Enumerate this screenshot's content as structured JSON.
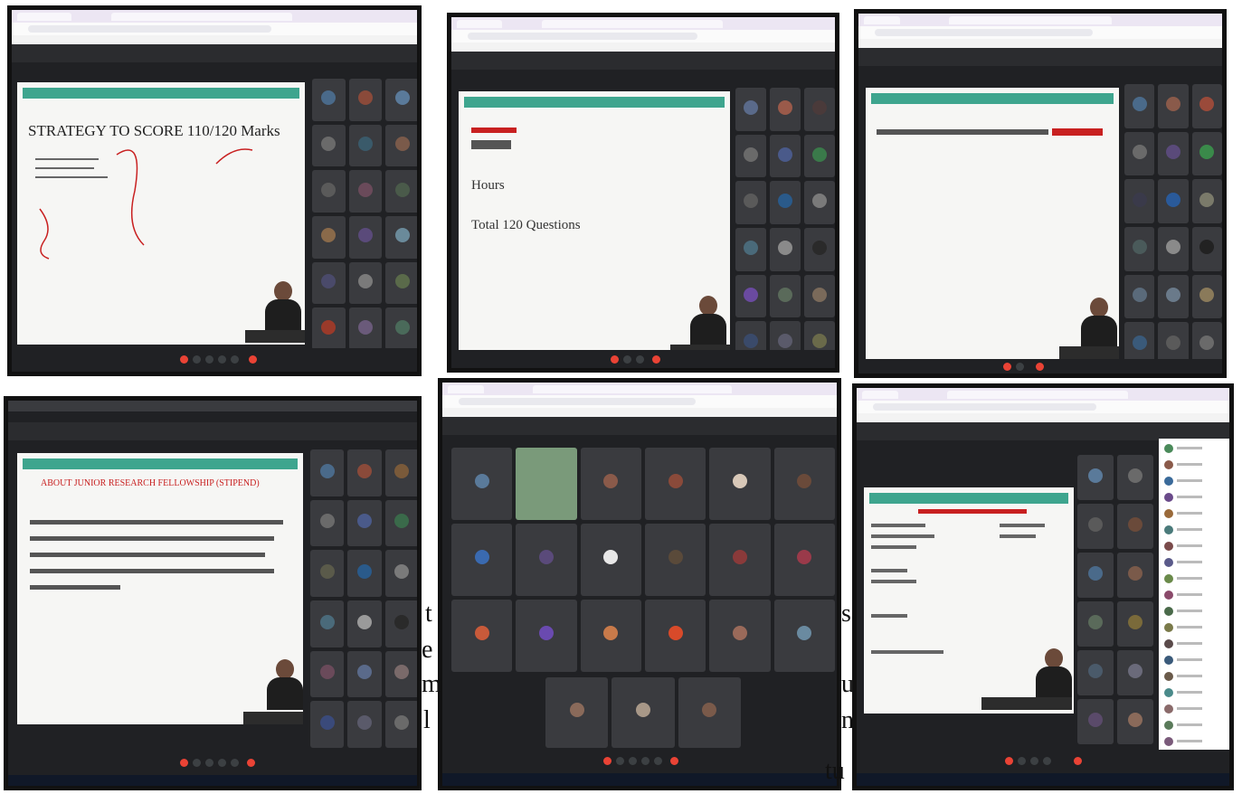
{
  "screenshots": [
    {
      "id": "s1",
      "slide_title": "STRATEGY TO SCORE 110/120 Marks",
      "slide_lines": [],
      "tile_colors": [
        "#4a6a8a",
        "#8a4a3a",
        "#5a7a9a",
        "#6a6a6a",
        "#3a5a6a",
        "#7a5a4a",
        "#5a5a5a",
        "#6a4a5a",
        "#4a5a4a",
        "#8a6a4a",
        "#5a4a7a",
        "#6a8a9a",
        "#4a4a6a",
        "#7a7a7a",
        "#5a6a4a",
        "#9a3a2a",
        "#6a5a7a",
        "#4a6a5a"
      ]
    },
    {
      "id": "s2",
      "slide_title": "",
      "slide_lines": [
        "Hours",
        "Total 120 Questions"
      ],
      "tile_colors": [
        "#5a6a8a",
        "#9a5a4a",
        "#4a3a3a",
        "#6a6a6a",
        "#4a5a8a",
        "#3a7a4a",
        "#5a5a5a",
        "#2a5a8a",
        "#7a7a7a",
        "#4a6a7a",
        "#8a8a8a",
        "#2a2a2a",
        "#6a4aa0",
        "#5a6a5a",
        "#7a6a5a",
        "#3a4a6a",
        "#5a5a6a",
        "#6a6a4a"
      ]
    },
    {
      "id": "s3",
      "slide_title": "",
      "slide_lines": [],
      "tile_colors": [
        "#4a6a8a",
        "#8a5a4a",
        "#9a4a3a",
        "#6a6a6a",
        "#5a4a7a",
        "#3a8a4a",
        "#3a3a4a",
        "#2a5a9a",
        "#7a7a6a",
        "#4a5a5a",
        "#8a8a8a",
        "#222222",
        "#5a6a7a",
        "#6a7a8a",
        "#8a7a5a",
        "#3a5a7a",
        "#5a5a5a",
        "#6a6a6a"
      ]
    },
    {
      "id": "s4",
      "slide_title": "ABOUT JUNIOR RESEARCH FELLOWSHIP (STIPEND)",
      "slide_lines": [],
      "tile_colors": [
        "#4a6a8a",
        "#8a4a3a",
        "#7a5a3a",
        "#6a6a6a",
        "#4a5a8a",
        "#3a6a4a",
        "#5a5a4a",
        "#2a5a8a",
        "#7a7a7a",
        "#4a6a7a",
        "#9a9a9a",
        "#2a2a2a",
        "#6a4a5a",
        "#5a6a8a",
        "#7a6a6a",
        "#3a4a7a",
        "#5a5a6a",
        "#6a6a6a"
      ]
    },
    {
      "id": "s5",
      "tile_colors": [
        "#5a7a9a",
        "#7a9a7a",
        "#8a5a4a",
        "#8a4a3a",
        "#d8c8b8",
        "#6a4a3a",
        "#3a6ab0",
        "#5a4a7a",
        "#e8e8e8",
        "#5a4a3a",
        "#8a3a3a",
        "#9a3a4a",
        "#c85a3a",
        "#6a4ab0",
        "#c87a4a",
        "#d84a2a",
        "#9a6a5a",
        "#6a8aa0",
        "#8a6a5a",
        "#a89888",
        "#7a5a4a"
      ]
    },
    {
      "id": "s6",
      "slide_title": "",
      "slide_lines": [],
      "tile_colors": [
        "#5a7a9a",
        "#6a6a6a",
        "#5a5a5a",
        "#6a4a3a",
        "#4a6a8a",
        "#7a5a4a",
        "#5a6a5a",
        "#7a6a3a",
        "#4a5a6a",
        "#6a6a7a",
        "#5a4a6a",
        "#8a6a5a"
      ],
      "chat_colors": [
        "#4a8a5a",
        "#8a5a4a",
        "#3a6a9a",
        "#6a4a8a",
        "#9a6a3a",
        "#4a7a7a",
        "#7a4a4a",
        "#5a5a8a",
        "#6a8a4a",
        "#8a4a6a",
        "#4a6a4a",
        "#7a7a4a",
        "#5a4a4a",
        "#3a5a7a",
        "#6a5a4a",
        "#4a8a8a",
        "#8a6a6a",
        "#5a7a5a",
        "#7a5a7a"
      ]
    }
  ],
  "overlay_text": {
    "line1_left": "t",
    "line1_right": "s",
    "line2_left": "e",
    "line3_left": "m",
    "line3_right": "u",
    "line4_left": "l",
    "line4_right": "n",
    "line5_right": "tu"
  }
}
